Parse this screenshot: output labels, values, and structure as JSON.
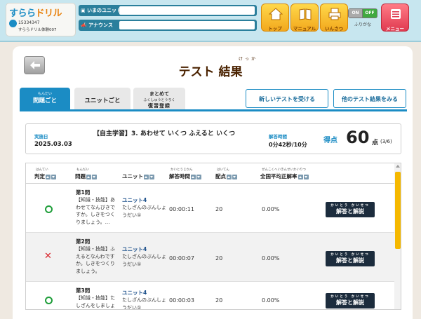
{
  "header": {
    "logo_main": "すらら",
    "logo_accent": "ドリル",
    "user_id": "15334347",
    "user_name": "すららドリル体験007",
    "unit_label": "いまのユニット",
    "news_label": "アナウンス",
    "nav": [
      {
        "label": "トップ",
        "icon": "home-icon"
      },
      {
        "label": "マニュアル",
        "icon": "book-icon"
      },
      {
        "label": "いんさつ",
        "icon": "printer-icon"
      },
      {
        "label": "メニュー",
        "icon": "menu-icon"
      }
    ],
    "toggle_on": "ON",
    "toggle_off": "OFF",
    "toggle_caption": "ふりがな"
  },
  "page": {
    "title": "テスト 結果",
    "title_ruby": "けっか"
  },
  "tabs": [
    {
      "ruby": "もんだい",
      "label": "問題ごと",
      "active": true
    },
    {
      "label": "ユニットごと"
    },
    {
      "line1": "まとめて",
      "ruby": "ふくしゅうとうろく",
      "line2": "復習登録"
    }
  ],
  "actions": {
    "new_test": "新しいテストを受ける",
    "other_results": "他のテスト結果をみる"
  },
  "summary": {
    "date_label": "実施日",
    "date": "2025.03.03",
    "test_name": "【自主学習】3. あわせて いくつ ふえると いくつ",
    "time_label": "解答時間",
    "time": "0分42秒/10分",
    "score_label": "得点",
    "score": "60",
    "score_unit": "点",
    "score_fraction": "(3/6)"
  },
  "table": {
    "columns": [
      {
        "ruby": "はんてい",
        "label": "判定"
      },
      {
        "ruby": "もんだい",
        "label": "問題"
      },
      {
        "label": "ユニット"
      },
      {
        "ruby": "かいとうじかん",
        "label": "解答時間"
      },
      {
        "ruby": "はいてん",
        "label": "配点"
      },
      {
        "ruby": "ぜんこくへいきんせいかいりつ",
        "label": "全国平均正解率"
      }
    ],
    "rows": [
      {
        "result": "correct",
        "q_title": "第1問",
        "q_text": "【知識・技能】あわせてなんびきですか。しきをつくりましょう。…",
        "unit_title": "ユニット4",
        "unit_text": "たしざんのぶんしょうだい①",
        "time": "00:00:11",
        "points": "20",
        "avg": "0.00%",
        "button": "解答と解説",
        "button_ruby": "かいとう かいせつ"
      },
      {
        "result": "wrong",
        "q_title": "第2問",
        "q_text": "【知識・技能】ふえるとなんわですか。しきをつくりましょう。",
        "unit_title": "ユニット4",
        "unit_text": "たしざんのぶんしょうだい①",
        "time": "00:00:07",
        "points": "20",
        "avg": "0.00%",
        "button": "解答と解説",
        "button_ruby": "かいとう かいせつ"
      },
      {
        "result": "correct",
        "q_title": "第3問",
        "q_text": "【知識・技能】たしざんをしましょう。",
        "unit_title": "ユニット4",
        "unit_text": "たしざんのぶんしょうだい①",
        "time": "00:00:03",
        "points": "20",
        "avg": "0.00%",
        "button": "解答と解説",
        "button_ruby": "かいとう かいせつ"
      }
    ]
  },
  "colors": {
    "accent": "#1b8cc4",
    "correct": "#1f9e3a",
    "wrong": "#d8232a",
    "nav_button": "#f2a81d",
    "menu_button": "#e03a50"
  }
}
